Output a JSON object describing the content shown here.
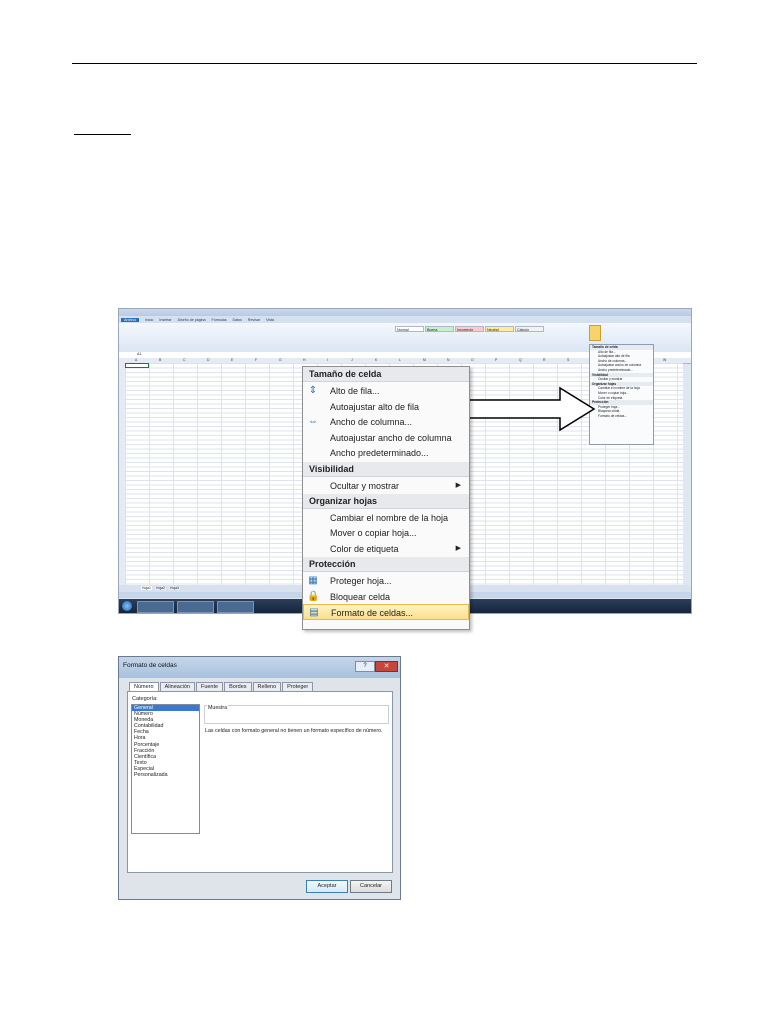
{
  "excel": {
    "tabs": [
      "Archivo",
      "Inicio",
      "Insertar",
      "Diseño de página",
      "Fórmulas",
      "Datos",
      "Revisar",
      "Vista"
    ],
    "cell_ref": "A1",
    "styles": [
      {
        "label": "Normal",
        "color": "#ffffff"
      },
      {
        "label": "Buena",
        "color": "#c6efce"
      },
      {
        "label": "Incorrecto",
        "color": "#ffc7ce"
      },
      {
        "label": "Neutral",
        "color": "#ffeb9c"
      },
      {
        "label": "Cálculo",
        "color": "#f2f2f2"
      }
    ],
    "columns": [
      "A",
      "B",
      "C",
      "D",
      "E",
      "F",
      "G",
      "H",
      "I",
      "J",
      "K",
      "L",
      "M",
      "N",
      "O",
      "P",
      "Q",
      "R",
      "S",
      "T",
      "U",
      "V",
      "W"
    ],
    "sheets": [
      "Hoja1",
      "Hoja2",
      "Hoja3"
    ],
    "submenu": [
      {
        "label": "Tamaño de celda",
        "head": true
      },
      {
        "label": "Alto de fila..."
      },
      {
        "label": "Autoajustar alto de fila"
      },
      {
        "label": "Ancho de columna..."
      },
      {
        "label": "Autoajustar ancho de columna"
      },
      {
        "label": "Ancho predeterminado..."
      },
      {
        "label": "Visibilidad",
        "head": true
      },
      {
        "label": "Ocultar y mostrar"
      },
      {
        "label": "Organizar hojas",
        "head": true
      },
      {
        "label": "Cambiar el nombre de la hoja"
      },
      {
        "label": "Mover o copiar hoja..."
      },
      {
        "label": "Color de etiqueta"
      },
      {
        "label": "Protección",
        "head": true
      },
      {
        "label": "Proteger hoja..."
      },
      {
        "label": "Bloquear celda"
      },
      {
        "label": "Formato de celdas..."
      }
    ]
  },
  "context_menu": {
    "sections": [
      {
        "header": "Tamaño de celda",
        "items": [
          {
            "label": "Alto de fila...",
            "icon": "row-height-icon"
          },
          {
            "label": "Autoajustar alto de fila"
          },
          {
            "label": "Ancho de columna...",
            "icon": "column-width-icon"
          },
          {
            "label": "Autoajustar ancho de columna"
          },
          {
            "label": "Ancho predeterminado..."
          }
        ]
      },
      {
        "header": "Visibilidad",
        "items": [
          {
            "label": "Ocultar y mostrar",
            "submenu": true
          }
        ]
      },
      {
        "header": "Organizar hojas",
        "items": [
          {
            "label": "Cambiar el nombre de la hoja"
          },
          {
            "label": "Mover o copiar hoja..."
          },
          {
            "label": "Color de etiqueta",
            "submenu": true
          }
        ]
      },
      {
        "header": "Protección",
        "items": [
          {
            "label": "Proteger hoja...",
            "icon": "protect-sheet-icon"
          },
          {
            "label": "Bloquear celda",
            "icon": "lock-icon"
          },
          {
            "label": "Formato de celdas...",
            "icon": "format-cells-icon",
            "highlighted": true
          }
        ]
      }
    ]
  },
  "dialog": {
    "title": "Formato de celdas",
    "tabs": [
      "Número",
      "Alineación",
      "Fuente",
      "Bordes",
      "Relleno",
      "Proteger"
    ],
    "category_label": "Categoría:",
    "categories": [
      "General",
      "Número",
      "Moneda",
      "Contabilidad",
      "Fecha",
      "Hora",
      "Porcentaje",
      "Fracción",
      "Científica",
      "Texto",
      "Especial",
      "Personalizada"
    ],
    "selected_category": "General",
    "sample_label": "Muestra",
    "description": "Las celdas con formato general no tienen un formato específico de número.",
    "ok_label": "Aceptar",
    "cancel_label": "Cancelar",
    "help_label": "?",
    "close_label": "✕"
  },
  "colors": {
    "highlight": "#fbe08c",
    "accent": "#2a6fb5",
    "selection": "#3a78d2"
  }
}
